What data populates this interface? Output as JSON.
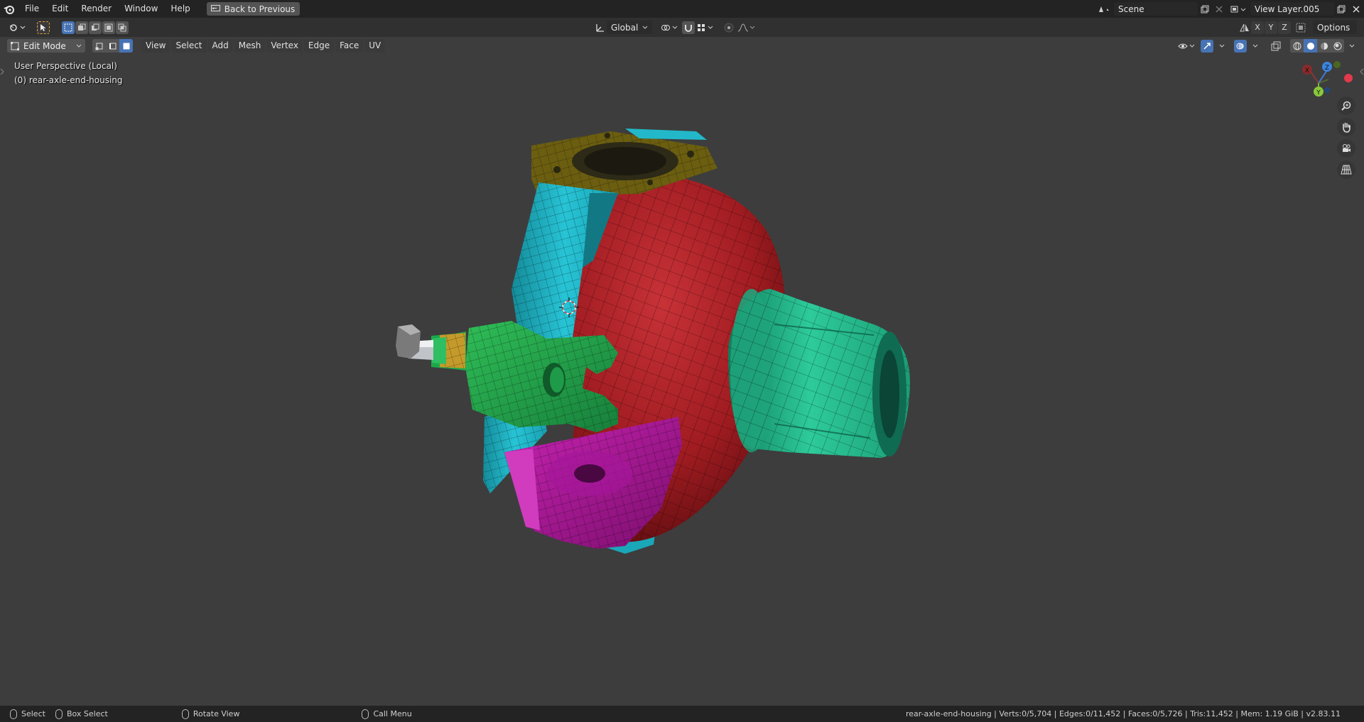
{
  "menu": {
    "items": [
      "File",
      "Edit",
      "Render",
      "Window",
      "Help"
    ],
    "back_button": "Back to Previous"
  },
  "top_right": {
    "scene_name": "Scene",
    "view_layer": "View Layer.005"
  },
  "tool_header": {
    "transform_orientation": "Global",
    "options_label": "Options",
    "axis_labels": [
      "X",
      "Y",
      "Z"
    ]
  },
  "viewport_header": {
    "mode": "Edit Mode",
    "menus": [
      "View",
      "Select",
      "Add",
      "Mesh",
      "Vertex",
      "Edge",
      "Face",
      "UV"
    ]
  },
  "viewport": {
    "perspective_label": "User Perspective (Local)",
    "object_label": "(0) rear-axle-end-housing",
    "gizmo_axes": {
      "x": "X",
      "y": "Y",
      "z": "Z"
    },
    "colors": {
      "background": "#3d3d3d",
      "red_part": "#a61f24",
      "cyan_part": "#1ab2c4",
      "green_part": "#22a85f",
      "teal_part": "#1fb88a",
      "magenta_part": "#b0189e",
      "olive_part": "#6b5e10",
      "gold_part": "#c49a2a"
    }
  },
  "status": {
    "select": "Select",
    "box_select": "Box Select",
    "rotate_view": "Rotate View",
    "call_menu": "Call Menu",
    "stats": "rear-axle-end-housing | Verts:0/5,704 | Edges:0/11,452 | Faces:0/5,726 | Tris:11,452 | Mem: 1.19 GiB | v2.83.11"
  }
}
